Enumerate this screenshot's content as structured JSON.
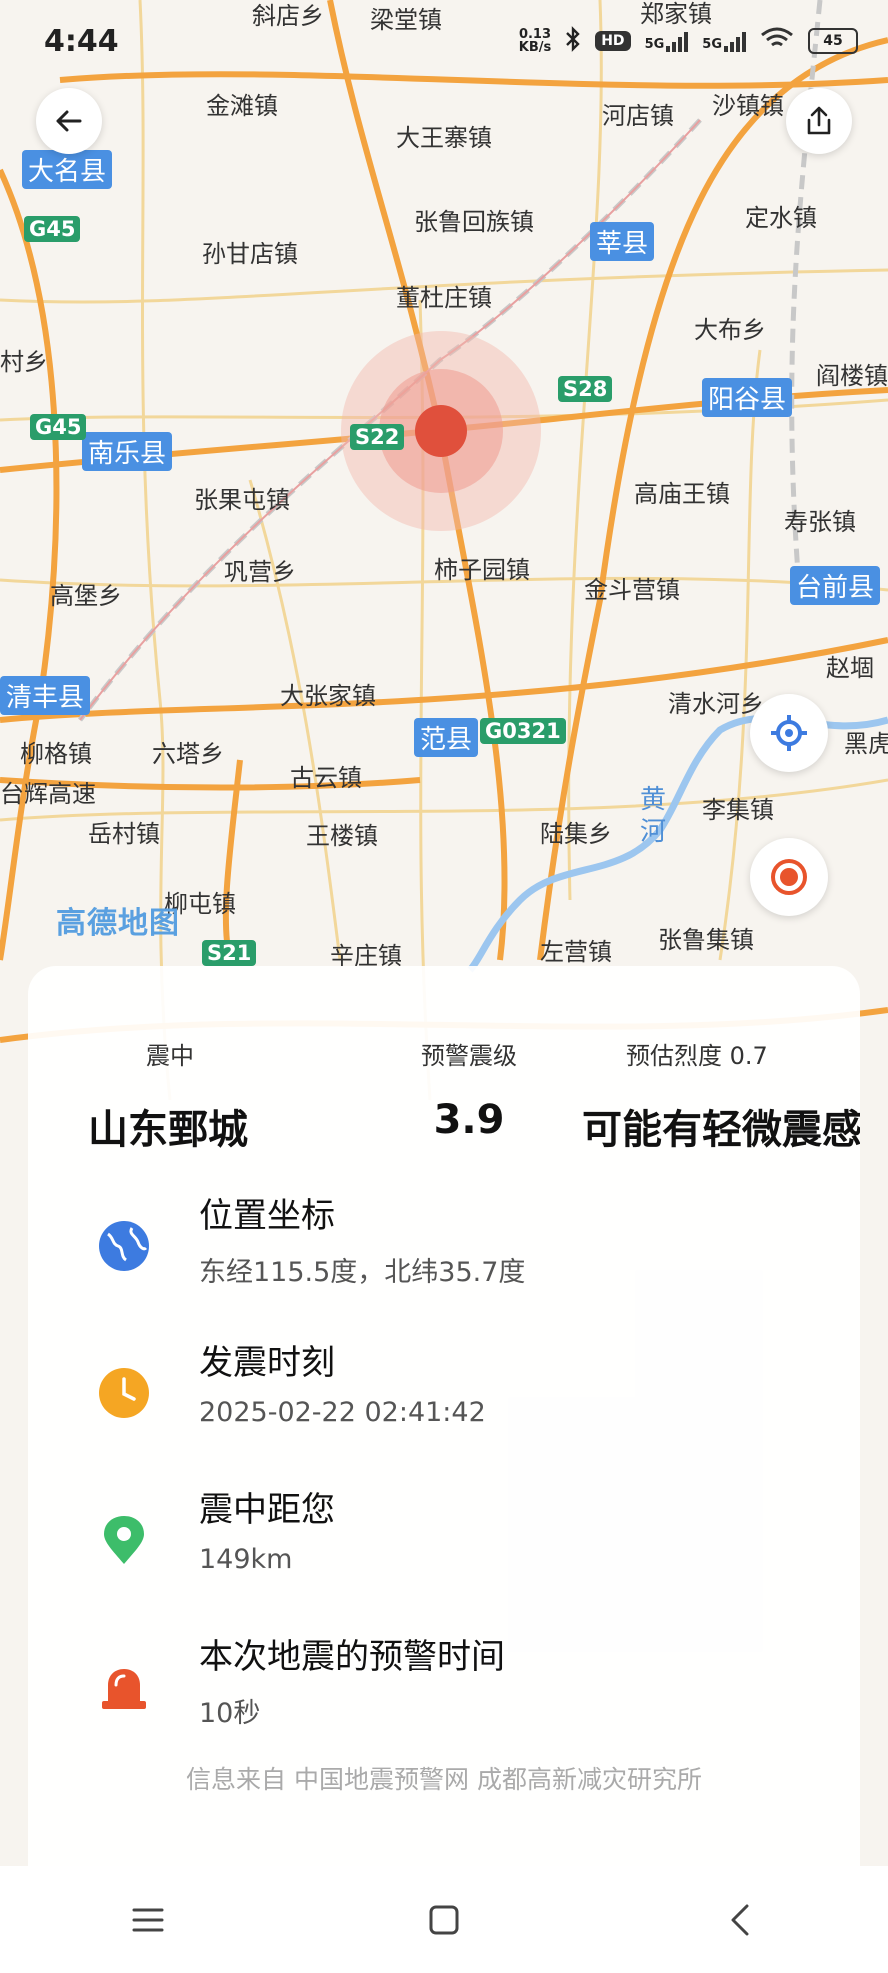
{
  "status_bar": {
    "time": "4:44",
    "net_speed_value": "0.13",
    "net_speed_unit": "KB/s",
    "hd_badge": "HD",
    "network_1": "5G",
    "network_2": "5G",
    "battery": "45"
  },
  "map": {
    "labels": [
      "金滩镇",
      "大王寨镇",
      "河店镇",
      "沙镇镇",
      "张鲁回族镇",
      "孙甘店镇",
      "定水镇",
      "董杜庄镇",
      "大布乡",
      "阎楼镇",
      "村乡",
      "张果屯镇",
      "高庙王镇",
      "寿张镇",
      "巩营乡",
      "柿子园镇",
      "金斗营镇",
      "高堡乡",
      "大张家镇",
      "清水河乡",
      "赵堌",
      "黑虎",
      "柳格镇",
      "六塔乡",
      "古云镇",
      "李集镇",
      "台辉高速",
      "岳村镇",
      "王楼镇",
      "陆集乡",
      "柳屯镇",
      "辛庄镇",
      "左营镇",
      "张鲁集镇",
      "梁堂镇",
      "郑家镇",
      "斜店乡"
    ],
    "counties": [
      "大名县",
      "莘县",
      "南乐县",
      "阳谷县",
      "台前县",
      "清丰县",
      "范县"
    ],
    "roads": [
      "G45",
      "G45",
      "S28",
      "S22",
      "G0321",
      "S21"
    ],
    "river": "黄河",
    "watermark": "高德地图",
    "accent_color": "#e0503c"
  },
  "card": {
    "epicenter_title": "震中",
    "epicenter_value": "山东鄄城",
    "magnitude_title": "预警震级",
    "magnitude_value": "3.9",
    "intensity_title": "预估烈度",
    "intensity_number": "0.7",
    "intensity_value": "可能有轻微震感",
    "items": [
      {
        "title": "位置坐标",
        "value": "东经115.5度，北纬35.7度",
        "icon": "globe-icon",
        "color": "#3d7be0"
      },
      {
        "title": "发震时刻",
        "value": "2025-02-22 02:41:42",
        "icon": "clock-icon",
        "color": "#f5a623"
      },
      {
        "title": "震中距您",
        "value": "149km",
        "icon": "location-pin-icon",
        "color": "#3dbd6a"
      },
      {
        "title": "本次地震的预警时间",
        "value": "10秒",
        "icon": "alarm-light-icon",
        "color": "#e8542c"
      }
    ],
    "source": "信息来自 中国地震预警网 成都高新减灾研究所"
  },
  "nav_bar": {
    "menu": "menu-icon",
    "home": "home-icon",
    "back": "back-icon"
  }
}
